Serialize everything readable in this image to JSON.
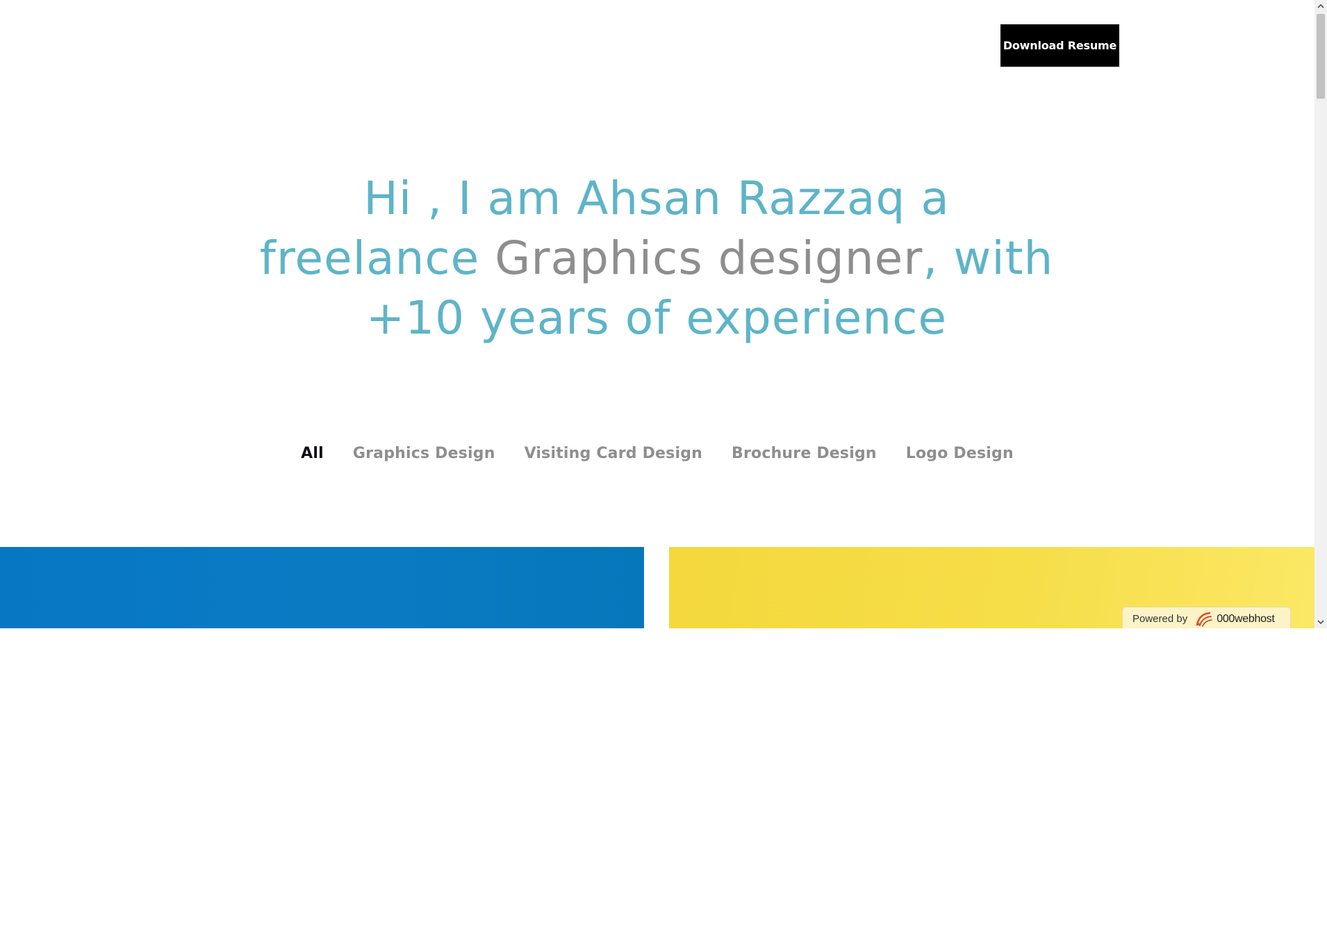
{
  "header": {
    "download_label": "Download Resume"
  },
  "hero": {
    "line1": "Hi , I am Ahsan Razzaq a",
    "line2_before": "freelance ",
    "line2_highlight": "Graphics designer",
    "line2_after": ", with",
    "line3": "+10 years of experience",
    "accent_color": "#5eb4c8",
    "highlight_color": "#8e8e8e"
  },
  "filters": {
    "items": [
      {
        "label": "All",
        "active": true
      },
      {
        "label": "Graphics Design",
        "active": false
      },
      {
        "label": "Visiting Card Design",
        "active": false
      },
      {
        "label": "Brochure Design",
        "active": false
      },
      {
        "label": "Logo Design",
        "active": false
      }
    ]
  },
  "portfolio": {
    "card_colors": [
      "#0a7bc3",
      "#f6de49"
    ]
  },
  "badge": {
    "prefix": "Powered by",
    "brand": "000webhost",
    "icon": "000webhost-logo-icon"
  },
  "scrollbar": {
    "up_icon": "chevron-up-icon",
    "down_icon": "chevron-down-icon"
  }
}
